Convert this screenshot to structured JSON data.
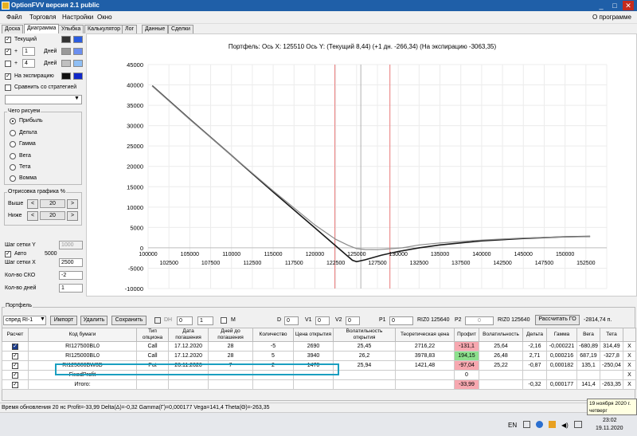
{
  "window": {
    "title": "OptionFVV версия 2.1 public",
    "minimize": "_",
    "maximize": "□",
    "close": "✕"
  },
  "menu": {
    "items": [
      "Файл",
      "Торговля",
      "Настройки",
      "Окно"
    ],
    "about": "О программе"
  },
  "tabs": [
    "Доска",
    "Диаграмма",
    "Улыбка",
    "Калькулятор",
    "Лог",
    "Данные",
    "Сделки"
  ],
  "active_tab": "Диаграмма",
  "left": {
    "current_label": "Текущий",
    "plus": "+",
    "days_label": "Дней",
    "days1": "1",
    "days2": "4",
    "expiry_label": "На экспирацию",
    "compare_label": "Сравнить со стратегией",
    "draw_group": "Чего рисуем",
    "draw_options": [
      "Прибыль",
      "Дельта",
      "Гамма",
      "Вега",
      "Тета",
      "Вомма"
    ],
    "scale_group": "Отрисовка графика %",
    "above_label": "Выше",
    "below_label": "Ниже",
    "above_val": "20",
    "below_val": "20",
    "arrow_left": "<",
    "arrow_right": ">",
    "grid_y_label": "Шаг сетки Y",
    "grid_y_val": "1000",
    "auto_label": "Авто",
    "auto_val": "5000",
    "grid_x_label": "Шаг сетки X",
    "grid_x_val": "2500",
    "sko_label": "Кол-во СКО",
    "sko_val": "-2",
    "days_count_label": "Кол-во дней",
    "days_count_val": "1"
  },
  "colors": {
    "current_dark": "#333333",
    "current_blue": "#2a5ce0",
    "plus1_a": "#999999",
    "plus1_b": "#6b8ff0",
    "plus4_a": "#c0c0c0",
    "plus4_b": "#8fbff5",
    "expiry_a": "#111111",
    "expiry_b": "#1028c8",
    "curve_expiry": "#1a1a1a",
    "curve_current": "#8a8a8a",
    "vline_red": "#e87878"
  },
  "chart_data": {
    "type": "line",
    "title": "Портфель: Ось X: 125510 Ось Y:  (Текущий 8,44)  (+1 дн. -266,34)  (На экспирацию -3063,35)",
    "xlim": [
      100000,
      155000
    ],
    "ylim": [
      -10000,
      45000
    ],
    "x_ticks_top": [
      "100000",
      "105000",
      "110000",
      "115000",
      "120000",
      "125000",
      "130000",
      "135000",
      "140000",
      "145000",
      "150000"
    ],
    "x_ticks_bottom": [
      "102500",
      "107500",
      "112500",
      "117500",
      "122500",
      "127500",
      "132500",
      "137500",
      "142500",
      "147500",
      "152500"
    ],
    "y_ticks": [
      "45000",
      "40000",
      "35000",
      "30000",
      "25000",
      "20000",
      "15000",
      "10000",
      "5000",
      "0",
      "-5000",
      "-10000"
    ],
    "grid": true,
    "cursor_x": 125510,
    "series": [
      {
        "x": [
          100500,
          105000,
          110000,
          115000,
          120000,
          123000,
          124500,
          125000,
          126000,
          128000,
          130000,
          132500,
          135000,
          140000,
          145000,
          150000,
          153000
        ],
        "y": [
          39800,
          31600,
          22700,
          13700,
          4900,
          -400,
          -3050,
          -3400,
          -2950,
          -1800,
          -900,
          0,
          700,
          1700,
          2300,
          2700,
          2800
        ]
      },
      {
        "x": [
          100500,
          105000,
          110000,
          115000,
          120000,
          122500,
          124000,
          125000,
          126000,
          127500,
          129000,
          130500,
          132500,
          135000,
          140000,
          145000,
          150000,
          153000
        ],
        "y": [
          39700,
          31500,
          22700,
          14000,
          5600,
          2100,
          600,
          -200,
          -400,
          -450,
          -250,
          0,
          700,
          1200,
          1900,
          2400,
          2700,
          2800
        ]
      }
    ],
    "vlines": [
      122400,
      129000
    ]
  },
  "portfolio": {
    "group_label": "Портфель",
    "select_val": "спред RI-1",
    "import": "Импорт",
    "delete": "Удалить",
    "save": "Сохранить",
    "dh_label": "DH",
    "dh_val1": "0",
    "dh_val2": "1",
    "m_label": "M",
    "d_label": "D",
    "d_val": "0",
    "v1_label": "V1",
    "v1_val": "0",
    "v2_label": "V2",
    "v2_val": "0",
    "p1_label": "P1",
    "p1_val": "0",
    "p1_info": "RIZ0 125640",
    "p2_label": "P2",
    "p2_val": "0",
    "p2_info": "RIZ0 125640",
    "calc_go": "Рассчитать ГО",
    "go_val": "-2814,74 п.",
    "headers": [
      "Расчет",
      "Код бумаги",
      "Тип опциона",
      "Дата погашения",
      "Дней до погашения",
      "Количество",
      "Цена открытия",
      "Волатильность открытия",
      "Теоретическая цена",
      "Профит",
      "Волатильность",
      "Дельта",
      "Гамма",
      "Вега",
      "Тета",
      ""
    ],
    "rows": [
      [
        "RI127500BL0",
        "Call",
        "17.12.2020",
        "28",
        "-5",
        "2690",
        "25,45",
        "2716,22",
        "-131,1",
        "25,64",
        "-2,16",
        "-0,000221",
        "-680,89",
        "314,49"
      ],
      [
        "RI125000BL0",
        "Call",
        "17.12.2020",
        "28",
        "5",
        "3940",
        "26,2",
        "3978,83",
        "194,15",
        "26,48",
        "2,71",
        "0,000216",
        "687,19",
        "-327,8"
      ],
      [
        "RI125000BW0D",
        "Put",
        "26.11.2020",
        "7",
        "2",
        "1470",
        "25,94",
        "1421,48",
        "-97,04",
        "25,22",
        "-0,87",
        "0,000182",
        "135,1",
        "-250,04"
      ],
      [
        "FixedProfit",
        "",
        "",
        "",
        "",
        "",
        "",
        "",
        "0",
        "",
        "",
        "",
        "",
        ""
      ],
      [
        "Итого:",
        "",
        "",
        "",
        "",
        "",
        "",
        "",
        "-33,99",
        "",
        "-0,32",
        "0,000177",
        "141,4",
        "-263,35"
      ]
    ],
    "close_x": "X"
  },
  "status": "Время обновления 20 нс  Profit=-33,99 Delta(Δ)=-0,32 Gamma(Γ)=0,000177 Vega=141,4 Theta(Θ)=-263,35",
  "taskbar": {
    "lang": "EN",
    "time": "23:02",
    "date": "19.11.2020"
  },
  "tooltip": {
    "line1": "19 ноября 2020 г.",
    "line2": "четверг"
  }
}
